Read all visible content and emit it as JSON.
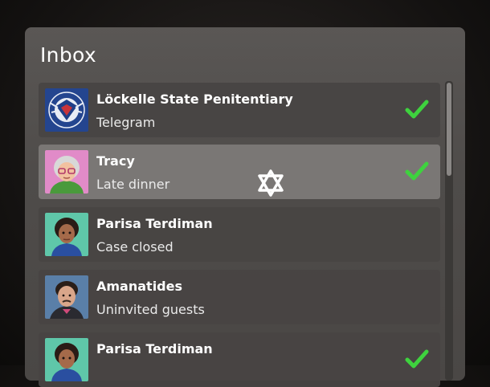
{
  "inbox": {
    "title": "Inbox",
    "messages": [
      {
        "sender": "Löckelle State Penitentiary",
        "subject": "Telegram",
        "avatar_icon": "penitentiary-seal-icon",
        "read": true,
        "selected": false
      },
      {
        "sender": "Tracy",
        "subject": "Late dinner",
        "avatar_icon": "tracy-portrait-icon",
        "read": true,
        "selected": true
      },
      {
        "sender": "Parisa Terdiman",
        "subject": "Case closed",
        "avatar_icon": "parisa-portrait-icon",
        "read": false,
        "selected": false
      },
      {
        "sender": "Amanatides",
        "subject": "Uninvited guests",
        "avatar_icon": "amanatides-portrait-icon",
        "read": false,
        "selected": false
      },
      {
        "sender": "Parisa Terdiman",
        "subject": "",
        "avatar_icon": "parisa-portrait-icon",
        "read": true,
        "selected": false
      }
    ]
  },
  "colors": {
    "check": "#3ed23e",
    "selected_row": "#7a7775",
    "row": "#484543"
  }
}
